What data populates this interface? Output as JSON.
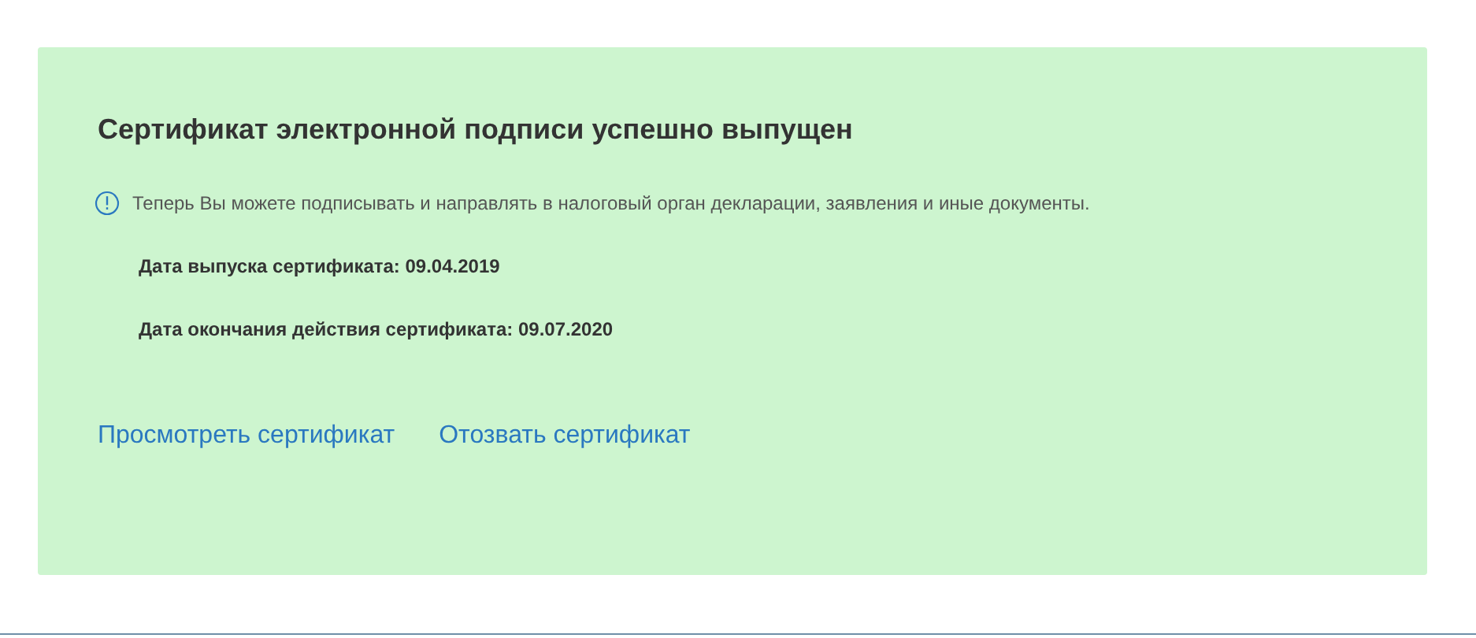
{
  "notice": {
    "title": "Сертификат электронной подписи успешно выпущен",
    "info": "Теперь Вы можете подписывать и направлять в налоговый орган декларации, заявления и иные документы.",
    "details": [
      "Дата выпуска сертификата: 09.04.2019",
      "Дата окончания действия сертификата: 09.07.2020"
    ],
    "links": [
      "Просмотреть сертификат",
      "Отозвать сертификат"
    ]
  }
}
